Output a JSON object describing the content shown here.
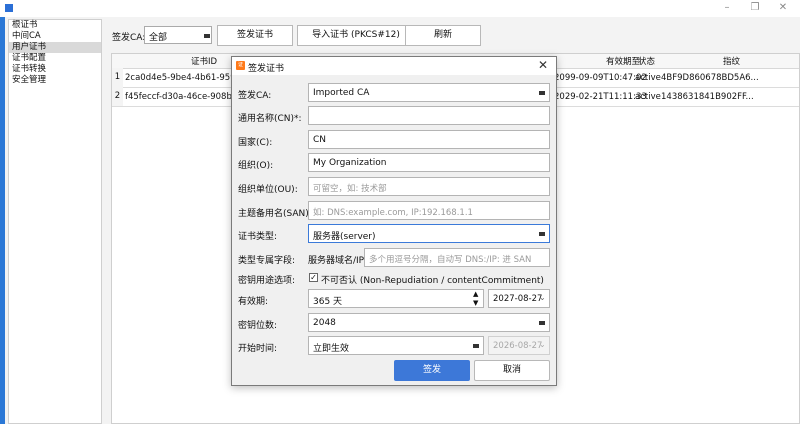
{
  "toolbar": {
    "issuer_label": "签发CA:",
    "issuer_value": "全部",
    "issue_button": "签发证书",
    "import_button": "导入证书 (PKCS#12)",
    "refresh_button": "刷新"
  },
  "sidebar": {
    "items": [
      "根证书",
      "中间CA",
      "用户证书",
      "证书配置",
      "证书转换",
      "安全管理"
    ],
    "selected": "用户证书"
  },
  "table": {
    "headers": {
      "cert_id": "证书ID",
      "expiry": "有效期至",
      "status": "状态",
      "fingerprint": "指纹"
    },
    "rows": [
      {
        "num": "1",
        "cert_id": "2ca0d4e5-9be4-4b61-959c-37",
        "expiry": "2099-09-09T10:47:02",
        "status": "active",
        "fingerprint": "4BF9D860678BD5A6..."
      },
      {
        "num": "2",
        "cert_id": "f45feccf-d30a-46ce-908b-9dc",
        "expiry": "2029-02-21T11:11:33",
        "status": "active",
        "fingerprint": "1438631841B902FF..."
      }
    ]
  },
  "dialog": {
    "title": "签发证书",
    "close_glyph": "✕",
    "icon_text": "证",
    "fields": {
      "issuer": {
        "label": "签发CA:",
        "value": "Imported CA"
      },
      "cn": {
        "label": "通用名称(CN)*:",
        "value": ""
      },
      "country": {
        "label": "国家(C):",
        "value": "CN"
      },
      "org": {
        "label": "组织(O):",
        "value": "My Organization"
      },
      "ou": {
        "label": "组织单位(OU):",
        "placeholder": "可留空，如: 技术部"
      },
      "san": {
        "label": "主题备用名(SAN):",
        "placeholder": "如: DNS:example.com, IP:192.168.1.1"
      },
      "cert_type": {
        "label": "证书类型:",
        "value": "服务器(server)"
      },
      "type_field": {
        "label": "类型专属字段:",
        "sublabel": "服务器域名/IP",
        "placeholder": "多个用逗号分隔，自动写 DNS:/IP: 进 SAN"
      },
      "key_usage": {
        "label": "密钥用途选项:",
        "check_label": "不可否认 (Non-Repudiation / contentCommitment)",
        "checked": true
      },
      "validity": {
        "label": "有效期:",
        "value": "365 天",
        "date": "2027-08-27"
      },
      "key_bits": {
        "label": "密钥位数:",
        "value": "2048"
      },
      "start": {
        "label": "开始时间:",
        "value": "立即生效",
        "date": "2026-08-27"
      }
    },
    "ok_button": "签发",
    "cancel_button": "取消"
  },
  "colors": {
    "accent": "#2b78d6",
    "primary_button": "#3d78d8",
    "dialog_icon": "#ff7a1a"
  }
}
